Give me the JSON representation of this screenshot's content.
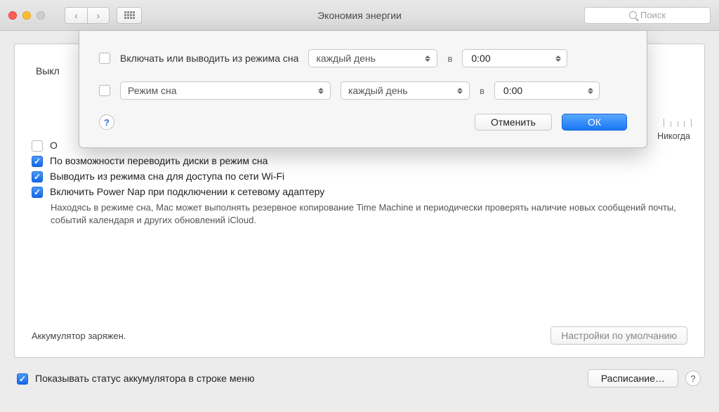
{
  "window": {
    "title": "Экономия энергии",
    "search_placeholder": "Поиск"
  },
  "panel": {
    "back_label_truncated": "Выкл",
    "never_label": "Никогда",
    "option0_label_truncated": "О",
    "option1_label": "По возможности переводить диски в режим сна",
    "option2_label": "Выводить из режима сна для доступа по сети Wi-Fi",
    "option3_label": "Включить Power Nap при подключении к сетевому адаптеру",
    "option3_note": "Находясь в режиме сна, Mac может выполнять резервное копирование Time Machine и периодически проверять наличие новых сообщений почты, событий календаря и других обновлений iCloud.",
    "battery_status": "Аккумулятор заряжен.",
    "defaults_button": "Настройки по умолчанию"
  },
  "footer": {
    "show_battery_label": "Показывать статус аккумулятора в строке меню",
    "schedule_button": "Расписание…"
  },
  "sheet": {
    "row1_label": "Включать или выводить из режима сна",
    "row1_day": "каждый день",
    "row1_at": "в",
    "row1_time": "0:00",
    "row2_label": "Режим сна",
    "row2_day": "каждый день",
    "row2_at": "в",
    "row2_time": "0:00",
    "cancel": "Отменить",
    "ok": "ОК"
  }
}
